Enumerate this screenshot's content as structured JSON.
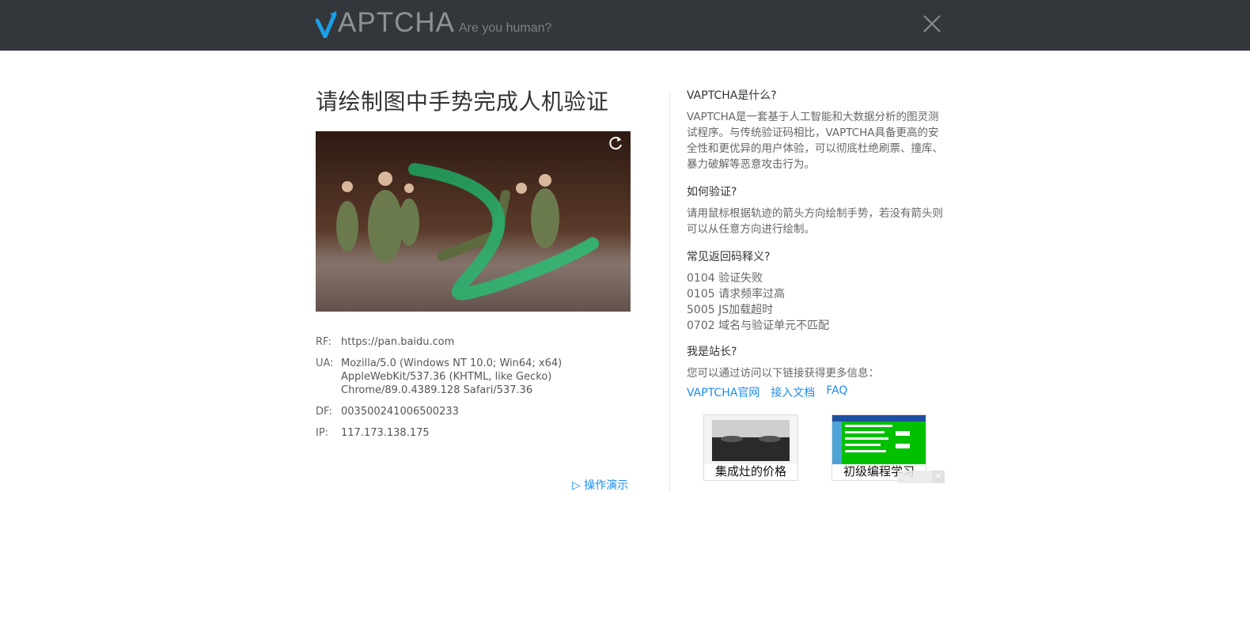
{
  "header": {
    "logo_text": "APTCHA",
    "tagline": "Are you human?",
    "accent_color": "#1aa0e8",
    "close_icon": "close-icon"
  },
  "challenge": {
    "headline": "请绘制图中手势完成人机验证",
    "refresh_icon": "refresh-icon",
    "demo_link": "▷ 操作演示"
  },
  "info": [
    {
      "key": "RF:",
      "value": "https://pan.baidu.com"
    },
    {
      "key": "UA:",
      "value": "Mozilla/5.0 (Windows NT 10.0; Win64; x64)\nAppleWebKit/537.36 (KHTML, like Gecko)\nChrome/89.0.4389.128 Safari/537.36"
    },
    {
      "key": "DF:",
      "value": "003500241006500233"
    },
    {
      "key": "IP:",
      "value": "117.173.138.175"
    }
  ],
  "faq": {
    "what_title": "VAPTCHA是什么?",
    "what_body": "VAPTCHA是一套基于人工智能和大数据分析的图灵测试程序。与传统验证码相比，VAPTCHA具备更高的安全性和更优异的用户体验，可以彻底杜绝刷票、撞库、暴力破解等恶意攻击行为。",
    "how_title": "如何验证?",
    "how_body": "请用鼠标根据轨迹的箭头方向绘制手势，若没有箭头则可以从任意方向进行绘制。",
    "codes_title": "常见返回码释义?",
    "codes": [
      "0104 验证失败",
      "0105 请求频率过高",
      "5005 JS加载超时",
      "0702 域名与验证单元不匹配"
    ],
    "owner_title": "我是站长?",
    "owner_body": "您可以通过访问以下链接获得更多信息：",
    "links": [
      "VAPTCHA官网",
      "接入文档",
      "FAQ"
    ]
  },
  "ads": [
    {
      "label": "集成灶的价格"
    },
    {
      "label": "初级编程学习"
    }
  ],
  "colors": {
    "topbar": "#33373b",
    "link": "#1b8cf2"
  }
}
